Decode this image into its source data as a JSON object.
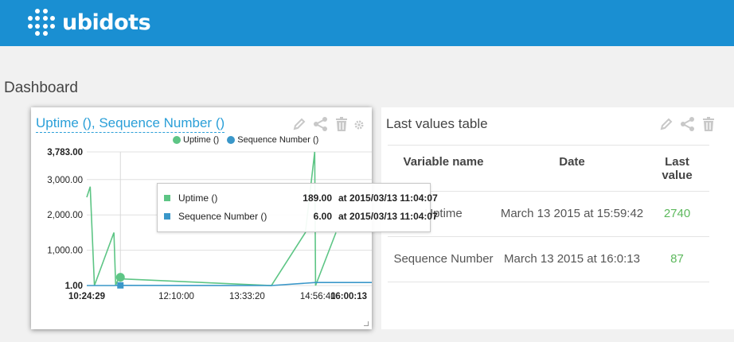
{
  "app": {
    "brand": "ubidots"
  },
  "page": {
    "title": "Dashboard"
  },
  "chart_widget": {
    "title": "Uptime (), Sequence Number ()",
    "icons": [
      "pencil-icon",
      "share-icon",
      "trash-icon",
      "gear-icon"
    ],
    "tooltip": {
      "rows": [
        {
          "name": "Uptime ()",
          "value": "189.00",
          "at": "at 2015/03/13 11:04:07",
          "color": "#5dc585"
        },
        {
          "name": "Sequence Number ()",
          "value": "6.00",
          "at": "at 2015/03/13 11:04:07",
          "color": "#3a97c9"
        }
      ]
    }
  },
  "chart_data": {
    "type": "line",
    "y_ticks": [
      "3,783.00",
      "3,000.00",
      "2,000.00",
      "1,000.00",
      "1.00"
    ],
    "x_ticks": [
      "10:24:29",
      "12:10:00",
      "13:33:20",
      "14:56:40",
      "16:00:13"
    ],
    "ylim": [
      1,
      3783
    ],
    "xlim_minutes": [
      624.48,
      960.22
    ],
    "series": [
      {
        "name": "Uptime",
        "color": "#5dc585",
        "points": [
          [
            624.48,
            2500
          ],
          [
            628.5,
            2800
          ],
          [
            633.5,
            1
          ],
          [
            656.5,
            1500
          ],
          [
            658.5,
            1
          ],
          [
            661.5,
            189
          ],
          [
            664.1,
            189
          ],
          [
            842,
            1
          ],
          [
            882,
            1500
          ],
          [
            893,
            3783
          ],
          [
            894,
            1
          ],
          [
            918,
            1500
          ]
        ]
      },
      {
        "name": "Sequence Number",
        "color": "#3a97c9",
        "points": [
          [
            624.48,
            1
          ],
          [
            656.5,
            1
          ],
          [
            660,
            6
          ],
          [
            664.1,
            6
          ],
          [
            842,
            1
          ],
          [
            894,
            87
          ],
          [
            960.22,
            87
          ]
        ]
      }
    ]
  },
  "legend": [
    {
      "label": "Uptime ()",
      "color": "#5dc585"
    },
    {
      "label": "Sequence Number ()",
      "color": "#3a97c9"
    }
  ],
  "table_widget": {
    "title": "Last values table",
    "icons": [
      "pencil-icon",
      "share-icon",
      "trash-icon"
    ],
    "headers": {
      "name": "Variable name",
      "date": "Date",
      "value": "Last value"
    },
    "rows": [
      {
        "name": "Uptime",
        "date": "March 13 2015 at 15:59:42",
        "value": "2740"
      },
      {
        "name": "Sequence Number",
        "date": "March 13 2015 at 16:0:13",
        "value": "87"
      }
    ]
  }
}
